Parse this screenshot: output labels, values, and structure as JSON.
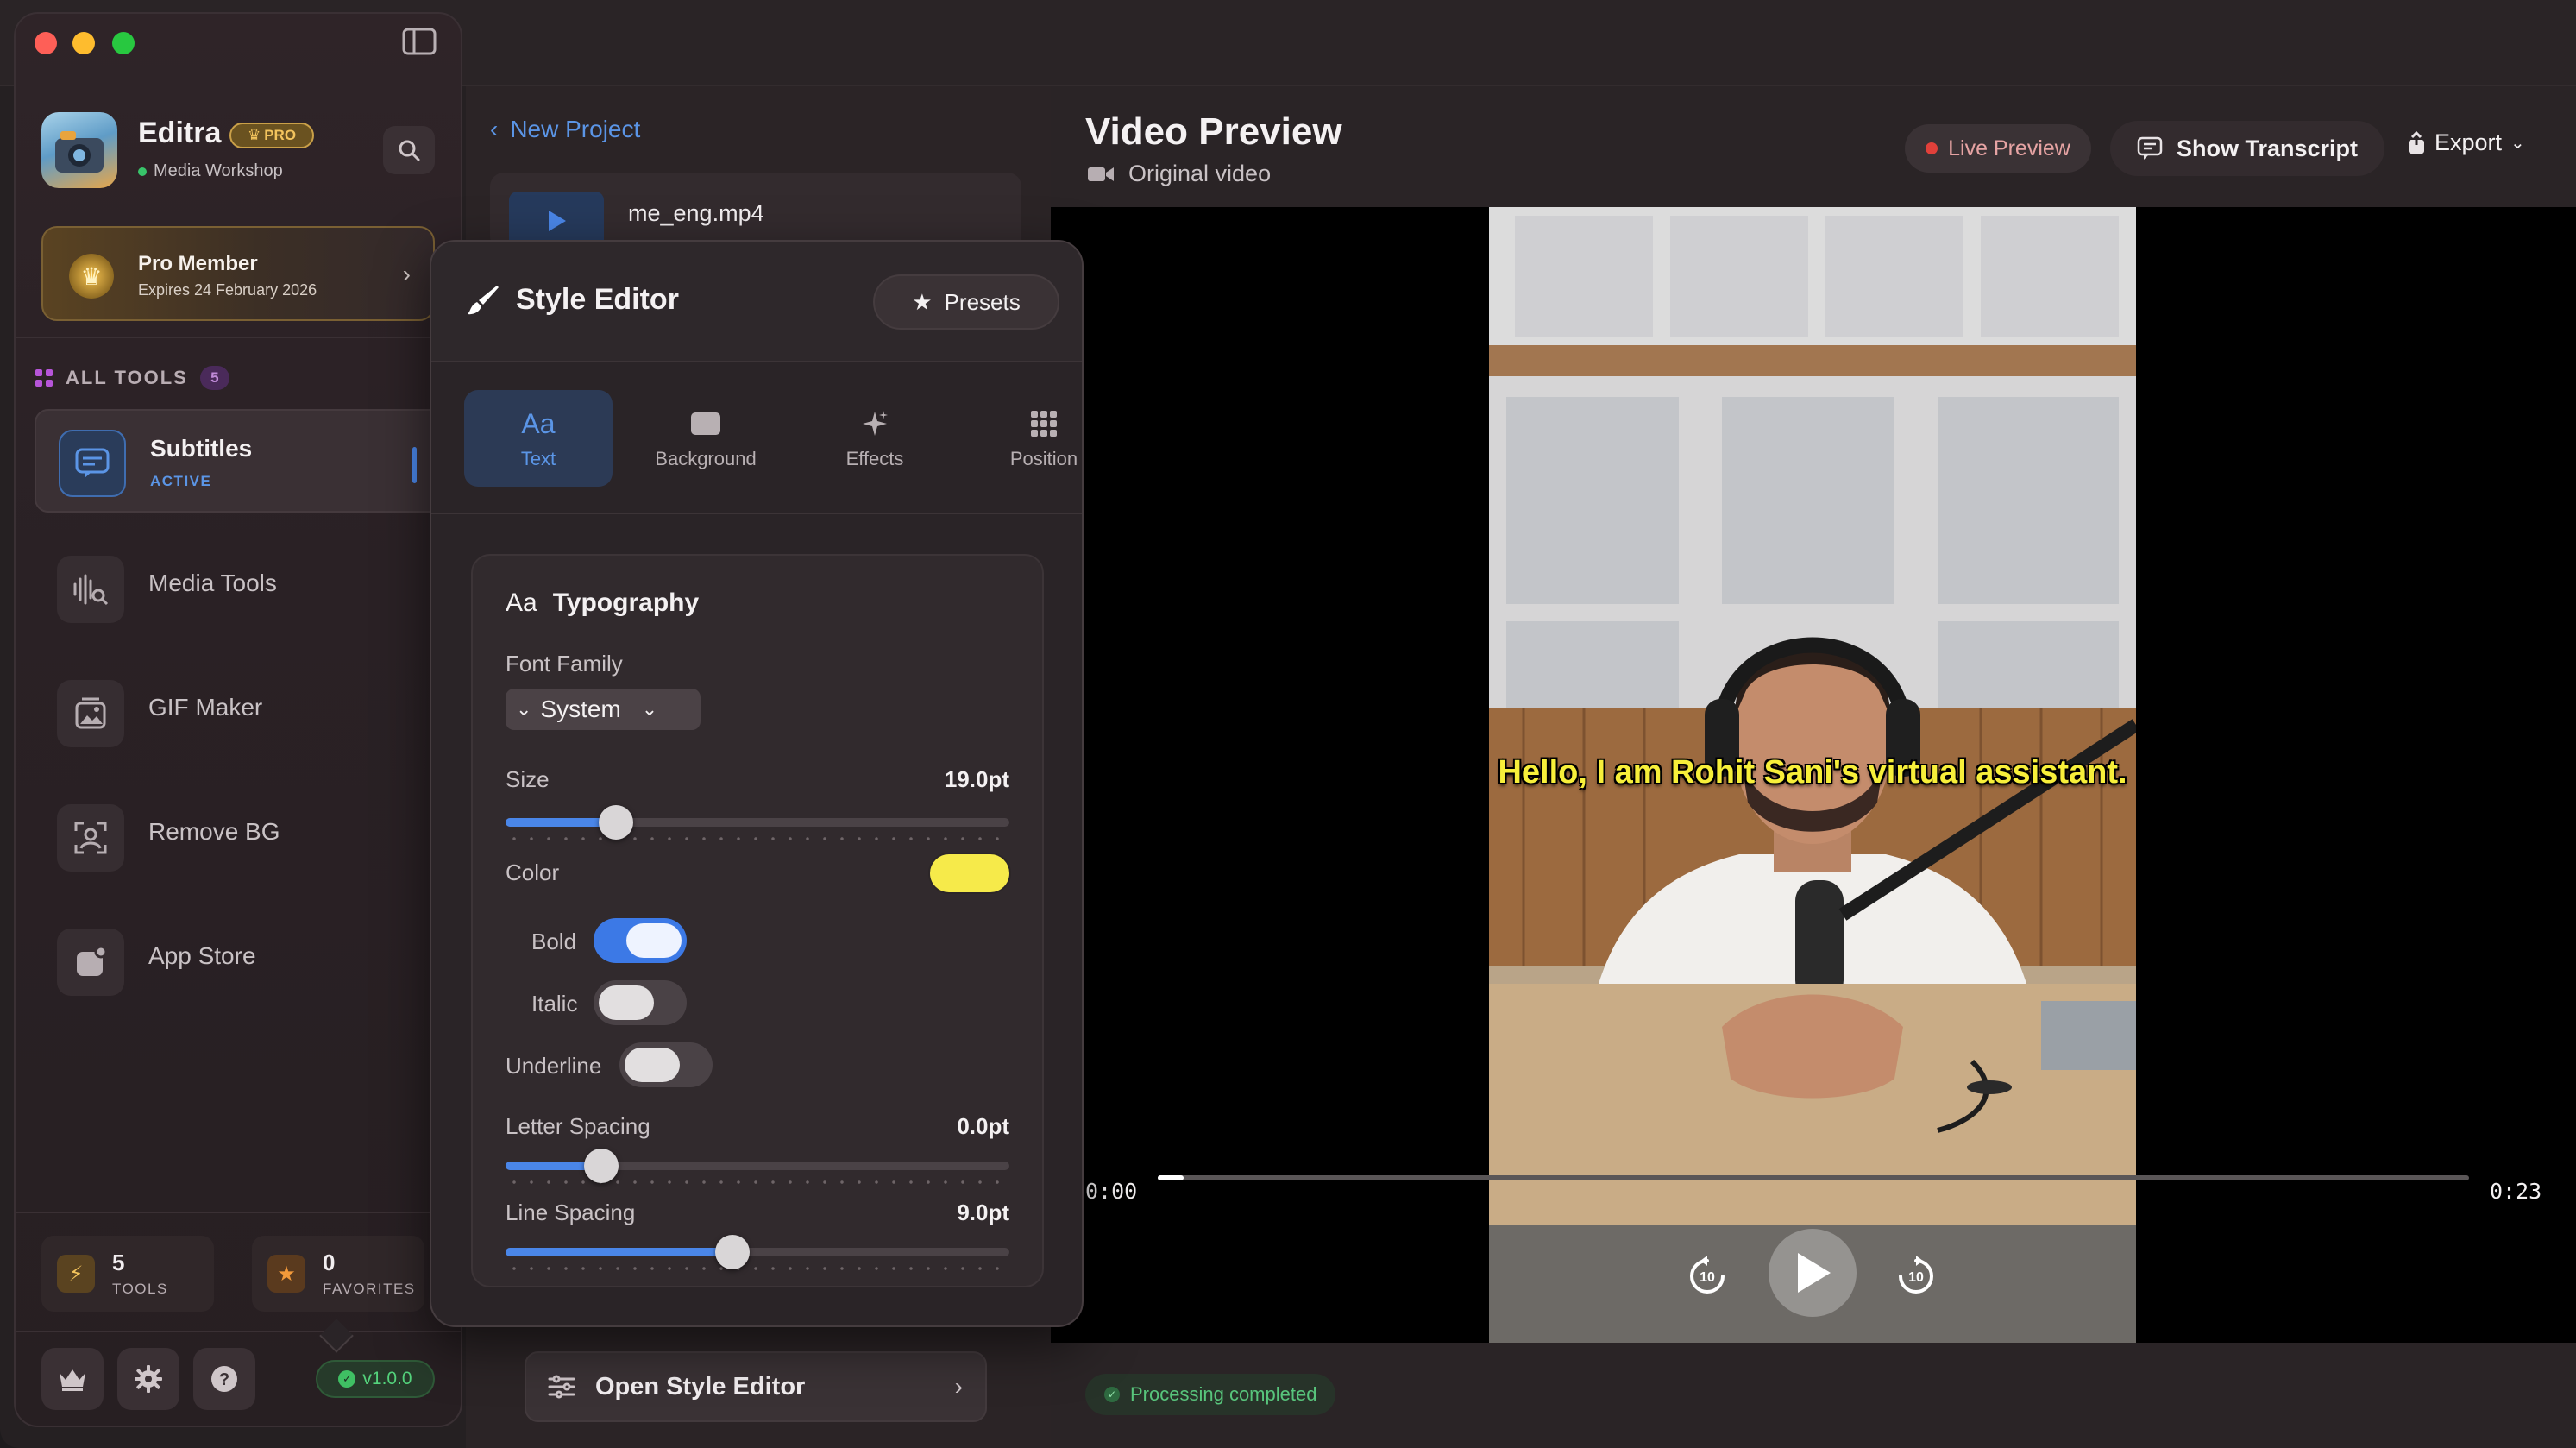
{
  "sidebar": {
    "app_name": "Editra",
    "pro_badge": "PRO",
    "subtitle": "Media Workshop",
    "pro_card": {
      "title": "Pro Member",
      "expires": "Expires 24 February 2026"
    },
    "all_tools_label": "ALL TOOLS",
    "all_tools_count": "5",
    "tools": [
      {
        "label": "Subtitles",
        "state": "ACTIVE",
        "icon": "subtitles-icon"
      },
      {
        "label": "Media Tools",
        "icon": "waveform-icon"
      },
      {
        "label": "GIF Maker",
        "icon": "image-icon"
      },
      {
        "label": "Remove BG",
        "icon": "person-icon"
      },
      {
        "label": "App Store",
        "icon": "appstore-icon"
      }
    ],
    "stats": [
      {
        "value": "5",
        "label": "TOOLS",
        "icon": "bolt-icon"
      },
      {
        "value": "0",
        "label": "FAVORITES",
        "icon": "star-icon"
      }
    ],
    "version": "v1.0.0"
  },
  "project": {
    "back_label": "New Project",
    "file_name": "me_eng.mp4",
    "open_style_editor": "Open Style Editor"
  },
  "style_editor": {
    "title": "Style Editor",
    "presets": "Presets",
    "tabs": [
      {
        "glyph": "Aa",
        "label": "Text"
      },
      {
        "label": "Background"
      },
      {
        "label": "Effects"
      },
      {
        "label": "Position"
      }
    ],
    "typography": {
      "heading_glyph": "Aa",
      "heading": "Typography",
      "font_family_label": "Font Family",
      "font_family_value": "System",
      "size_label": "Size",
      "size_value": "19.0pt",
      "size_fraction": 0.22,
      "color_label": "Color",
      "color_value": "#f6ea4a",
      "bold_label": "Bold",
      "bold_on": true,
      "italic_label": "Italic",
      "italic_on": false,
      "underline_label": "Underline",
      "underline_on": false,
      "letter_spacing_label": "Letter Spacing",
      "letter_spacing_value": "0.0pt",
      "letter_spacing_fraction": 0.19,
      "line_spacing_label": "Line Spacing",
      "line_spacing_value": "9.0pt",
      "line_spacing_fraction": 0.45
    }
  },
  "preview": {
    "title": "Video Preview",
    "subtitle": "Original video",
    "live_preview": "Live Preview",
    "show_transcript": "Show Transcript",
    "export": "Export",
    "caption": "Hello, I am Rohit Sani's virtual assistant.",
    "time_current": "0:00",
    "time_total": "0:23",
    "progress_fraction": 0.02,
    "skip_back": "10",
    "skip_forward": "10",
    "status": "Processing completed"
  },
  "colors": {
    "accent": "#4a86e8",
    "caption": "#f7ef3a",
    "success": "#58c57c",
    "live_dot": "#e0403a"
  }
}
